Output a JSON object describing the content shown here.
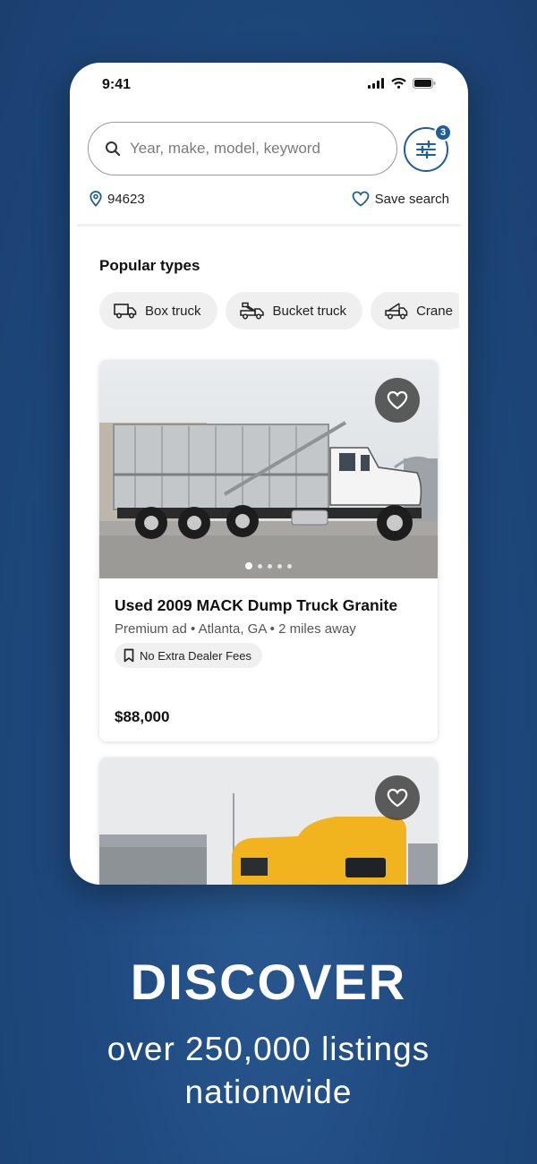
{
  "status": {
    "time": "9:41"
  },
  "search": {
    "placeholder": "Year, make, model, keyword",
    "filter_count": "3"
  },
  "location": {
    "zip": "94623",
    "save_label": "Save search"
  },
  "popular": {
    "title": "Popular types",
    "chips": [
      {
        "label": "Box truck",
        "icon": "box-truck-icon"
      },
      {
        "label": "Bucket truck",
        "icon": "bucket-truck-icon"
      },
      {
        "label": "Crane",
        "icon": "crane-truck-icon"
      }
    ]
  },
  "listing": {
    "title": "Used 2009 MACK Dump Truck Granite",
    "subtitle": "Premium ad • Atlanta, GA • 2 miles away",
    "badge": "No Extra Dealer Fees",
    "price": "$88,000",
    "photo_count": 5,
    "active_photo": 1
  },
  "promo": {
    "headline": "DISCOVER",
    "line1": "over 250,000 listings",
    "line2": "nationwide"
  },
  "colors": {
    "brand_blue": "#1c5d9c",
    "background": "#1f4a80"
  }
}
